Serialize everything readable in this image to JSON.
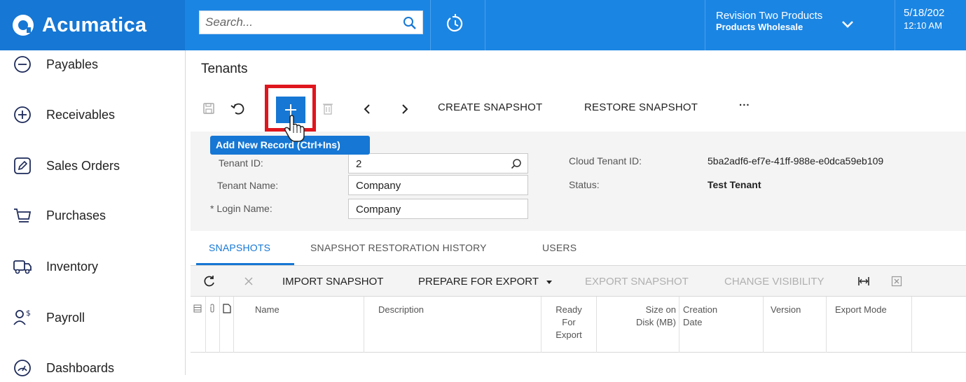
{
  "header": {
    "brand": "Acumatica",
    "search_placeholder": "Search...",
    "company_name": "Revision Two Products",
    "branch_name": "Products Wholesale",
    "date": "5/18/202",
    "time": "12:10 AM",
    "brand_color": "#1677d4",
    "bar_color": "#1b85e3"
  },
  "sidebar": {
    "items": [
      {
        "label": "Payables",
        "icon": "minus-circle-icon"
      },
      {
        "label": "Receivables",
        "icon": "plus-circle-icon"
      },
      {
        "label": "Sales Orders",
        "icon": "pencil-square-icon"
      },
      {
        "label": "Purchases",
        "icon": "cart-icon"
      },
      {
        "label": "Inventory",
        "icon": "truck-icon"
      },
      {
        "label": "Payroll",
        "icon": "user-dollar-icon"
      },
      {
        "label": "Dashboards",
        "icon": "gauge-icon"
      }
    ]
  },
  "page": {
    "title": "Tenants"
  },
  "toolbar": {
    "create_snapshot": "CREATE SNAPSHOT",
    "restore_snapshot": "RESTORE SNAPSHOT",
    "more": "···",
    "add_tooltip": "Add New Record (Ctrl+Ins)",
    "highlight_color": "#e0161e"
  },
  "form": {
    "tenant_id_label": "Tenant ID:",
    "tenant_id_value": "2",
    "tenant_name_label": "Tenant Name:",
    "tenant_name_value": "Company",
    "login_name_label": "Login Name:",
    "login_name_value": "Company",
    "required_mark": "*",
    "cloud_tenant_id_label": "Cloud Tenant ID:",
    "cloud_tenant_id_value": "5ba2adf6-ef7e-41ff-988e-e0dca59eb109",
    "status_label": "Status:",
    "status_value": "Test Tenant"
  },
  "tabs": [
    {
      "label": "SNAPSHOTS",
      "active": true
    },
    {
      "label": "SNAPSHOT RESTORATION HISTORY",
      "active": false
    },
    {
      "label": "USERS",
      "active": false
    }
  ],
  "grid_toolbar": {
    "import_snapshot": "IMPORT SNAPSHOT",
    "prepare_for_export": "PREPARE FOR EXPORT",
    "export_snapshot": "EXPORT SNAPSHOT",
    "change_visibility": "CHANGE VISIBILITY"
  },
  "grid_columns": {
    "name": "Name",
    "description": "Description",
    "ready_for_export_1": "Ready",
    "ready_for_export_2": "For",
    "ready_for_export_3": "Export",
    "size_on_disk_1": "Size on",
    "size_on_disk_2": "Disk (MB)",
    "creation_date_1": "Creation",
    "creation_date_2": "Date",
    "version": "Version",
    "export_mode": "Export Mode"
  }
}
